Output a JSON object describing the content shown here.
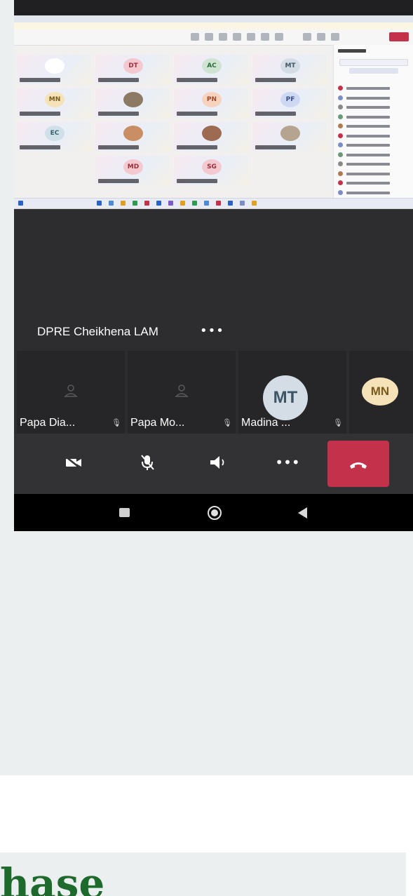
{
  "call": {
    "speaker_name": "DPRE Cheikhena LAM",
    "more_label": "•••"
  },
  "shared_screen": {
    "tiles": [
      {
        "initials": "",
        "bg": "#ffffff",
        "fg": "#555555"
      },
      {
        "initials": "DT",
        "bg": "#f3c9cf",
        "fg": "#9a2f3c"
      },
      {
        "initials": "AC",
        "bg": "#cfe3d2",
        "fg": "#2d6b3a"
      },
      {
        "initials": "MT",
        "bg": "#d4dde6",
        "fg": "#3e5566"
      },
      {
        "initials": "MN",
        "bg": "#f5e2b8",
        "fg": "#7a5a1a"
      },
      {
        "initials": "",
        "bg": "#8c7a64",
        "fg": "#ffffff"
      },
      {
        "initials": "PN",
        "bg": "#f7d2bf",
        "fg": "#9a4a2a"
      },
      {
        "initials": "PF",
        "bg": "#cfd8f2",
        "fg": "#3a4e8c"
      },
      {
        "initials": "EC",
        "bg": "#cfe0e8",
        "fg": "#35606e"
      },
      {
        "initials": "",
        "bg": "#c98e63",
        "fg": "#ffffff"
      },
      {
        "initials": "",
        "bg": "#9c6b52",
        "fg": "#ffffff"
      },
      {
        "initials": "",
        "bg": "#b5a48f",
        "fg": "#ffffff"
      },
      {
        "initials": "MD",
        "bg": "#f3c9cf",
        "fg": "#9a2f3c"
      },
      {
        "initials": "SG",
        "bg": "#f3c9cf",
        "fg": "#9a2f3c"
      }
    ]
  },
  "participants": [
    {
      "name": "Papa Dia...",
      "muted_icon": "mic-off-icon"
    },
    {
      "name": "Papa Mo...",
      "muted_icon": "mic-off-icon"
    },
    {
      "name": "Madina ...",
      "initials": "MT",
      "avatar_bg": "#d4dde6",
      "avatar_fg": "#3e5566",
      "muted_icon": "mic-off-icon"
    },
    {
      "initials": "MN",
      "avatar_bg": "#f5e2b8",
      "avatar_fg": "#7a5a1a"
    }
  ],
  "controls": {
    "camera": "camera-off-icon",
    "mic": "mic-off-icon",
    "speaker": "speaker-icon",
    "more": "•••",
    "end": "end-call-icon"
  },
  "navbar": {
    "recents": "recents-icon",
    "home": "home-icon",
    "back": "back-icon"
  },
  "article": {
    "heading": "hase"
  },
  "colors": {
    "end_call": "#c4314b",
    "heading": "#1e6a2c"
  }
}
